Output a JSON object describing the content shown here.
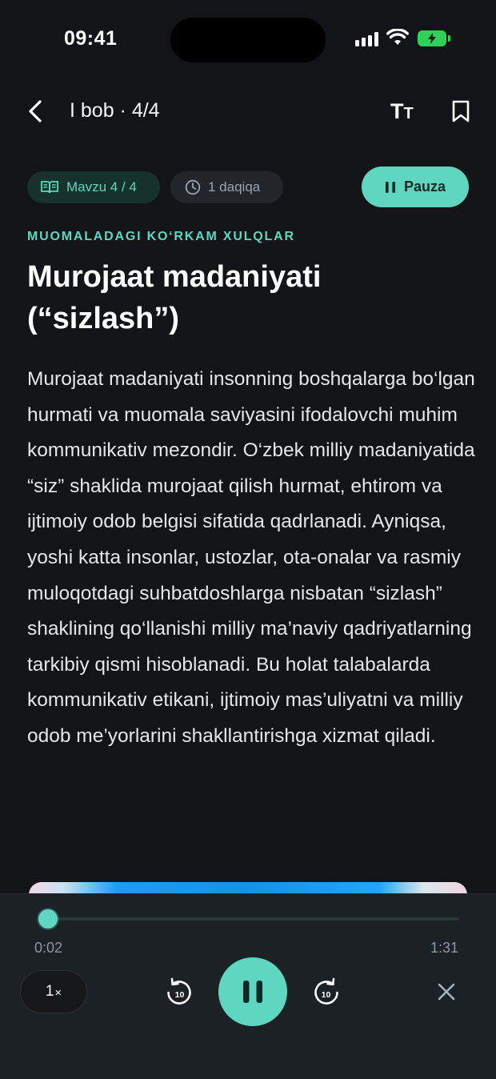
{
  "status_bar": {
    "time": "09:41"
  },
  "header": {
    "title": "I bob · 4/4",
    "text_size_label_big": "T",
    "text_size_label_small": "T"
  },
  "chips": {
    "topic": "Mavzu 4 / 4",
    "duration": "1 daqiqa",
    "pause_label": "Pauza"
  },
  "article": {
    "category": "MUOMALADAGI KO‘RKAM XULQLAR",
    "title": "Murojaat madaniyati (“sizlash”)",
    "body": "Murojaat madaniyati insonning boshqalarga bo‘lgan hurmati va muomala saviyasini ifodalovchi muhim kommunikativ mezondir. O‘zbek milliy madaniyatida “siz” shaklida murojaat qilish hurmat, ehtirom va ijtimoiy odob belgisi sifatida qadrlanadi. Ayniqsa, yoshi katta insonlar, ustozlar, ota-onalar va rasmiy muloqotdagi suhbatdoshlarga nisbatan “sizlash” shaklining qo‘llanishi milliy ma’naviy qadriyatlarning tarkibiy qismi hisoblanadi. Bu holat talabalarda kommunikativ etikani, ijtimoiy mas’uliyatni va milliy odob me’yorlarini shakllantirishga xizmat qiladi."
  },
  "player": {
    "current_time": "0:02",
    "total_time": "1:31",
    "progress": 0.022,
    "speed_number": "1",
    "speed_suffix": "×",
    "skip_back_seconds": "10",
    "skip_forward_seconds": "10"
  },
  "colors": {
    "accent": "#5fd7c0",
    "background": "#121417",
    "player_background": "#1c2126",
    "battery": "#30d158"
  },
  "icons": [
    "back-arrow-icon",
    "text-size-icon",
    "bookmark-icon",
    "book-icon",
    "clock-icon",
    "pause-icon",
    "rewind-10-icon",
    "forward-10-icon",
    "close-icon"
  ]
}
